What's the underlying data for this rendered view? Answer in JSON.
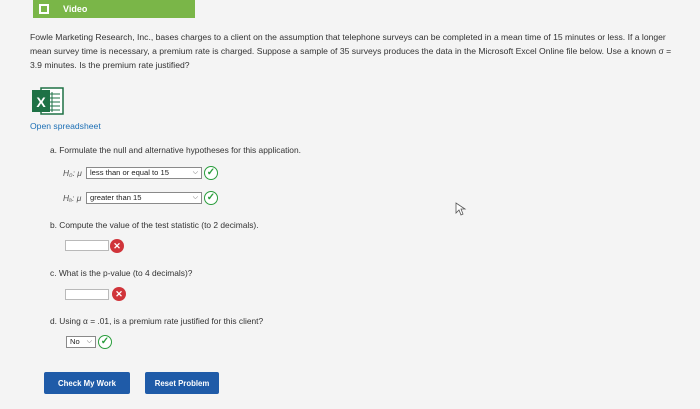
{
  "video": {
    "label": "Video"
  },
  "problem": {
    "text": "Fowle Marketing Research, Inc., bases charges to a client on the assumption that telephone surveys can be completed in a mean time of 15 minutes or less. If a longer mean survey time is necessary, a premium rate is charged. Suppose a sample of 35 surveys produces the data in the Microsoft Excel Online file below. Use a known σ = 3.9 minutes. Is the premium rate justified?"
  },
  "spreadsheet": {
    "icon_letter": "X",
    "open_label": "Open spreadsheet"
  },
  "part_a": {
    "prompt": "a. Formulate the null and alternative hypotheses for this application.",
    "h0_label": "H₀: μ",
    "h0_value": "less than or equal to 15",
    "ha_label": "Hₐ: μ",
    "ha_value": "greater than 15"
  },
  "part_b": {
    "prompt": "b. Compute the value of the test statistic (to 2 decimals).",
    "value": ""
  },
  "part_c": {
    "prompt": "c. What is the p-value (to 4 decimals)?",
    "value": ""
  },
  "part_d": {
    "prompt": "d. Using α = .01, is a premium rate justified for this client?",
    "value": "No"
  },
  "buttons": {
    "check": "Check My Work",
    "reset": "Reset Problem"
  },
  "colors": {
    "accent": "#1f5ba8",
    "video": "#7ab648",
    "correct": "#2a9d3c",
    "incorrect": "#d0343a",
    "excel": "#1e7145"
  },
  "icons": {
    "correct": "check-circle-icon",
    "incorrect": "x-circle-icon",
    "excel": "excel-icon"
  }
}
